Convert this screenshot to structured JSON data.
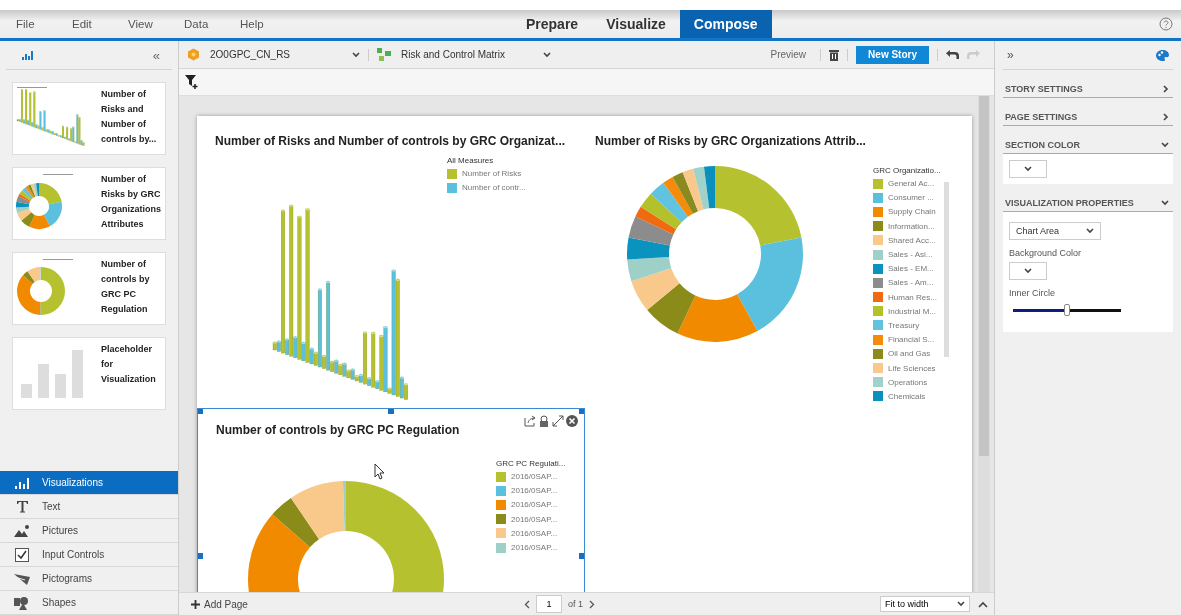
{
  "menu": [
    "File",
    "Edit",
    "View",
    "Data",
    "Help"
  ],
  "modes": [
    {
      "label": "Prepare",
      "selected": false
    },
    {
      "label": "Visualize",
      "selected": false
    },
    {
      "label": "Compose",
      "selected": true
    }
  ],
  "left_panel": {
    "collapse": "«",
    "thumbnails": [
      {
        "title": "Number of Risks and Number of controls by...",
        "kind": "bars"
      },
      {
        "title": "Number of Risks by GRC Organizations Attributes",
        "kind": "donut"
      },
      {
        "title": "Number of controls by GRC PC Regulation",
        "kind": "donut2"
      },
      {
        "title": "Placeholder for Visualization",
        "kind": "placeholder"
      }
    ],
    "tools": [
      {
        "label": "Visualizations",
        "kind": "viz",
        "selected": true
      },
      {
        "label": "Text",
        "kind": "text",
        "selected": false
      },
      {
        "label": "Pictures",
        "kind": "pictures",
        "selected": false
      },
      {
        "label": "Input Controls",
        "kind": "input",
        "selected": false
      },
      {
        "label": "Pictograms",
        "kind": "pictograms",
        "selected": false
      },
      {
        "label": "Shapes",
        "kind": "shapes",
        "selected": false
      }
    ]
  },
  "toolbar": {
    "dataset": "2O0GPC_CN_RS",
    "document": "Risk and Control Matrix",
    "preview": "Preview",
    "new_story": "New Story"
  },
  "charts": [
    {
      "kind": "bars",
      "selected": false,
      "title": "Number of Risks and Number of controls by GRC Organizat...",
      "legend_title": "All Measures",
      "legend": [
        {
          "label": "Number of Risks",
          "color": "#b5c12f"
        },
        {
          "label": "Number of contr...",
          "color": "#5bc0de"
        }
      ]
    },
    {
      "kind": "donut",
      "selected": false,
      "title": "Number of Risks by GRC Organizations Attrib...",
      "legend_title": "GRC Organizatio...",
      "legend": [
        {
          "label": "General Ac...",
          "color": "#b5c12f"
        },
        {
          "label": "Consumer ...",
          "color": "#5bc0de"
        },
        {
          "label": "Supply Chain",
          "color": "#f28a00"
        },
        {
          "label": "Information...",
          "color": "#8b8b1a"
        },
        {
          "label": "Shared Acc...",
          "color": "#f8c98a"
        },
        {
          "label": "Sales - Asi...",
          "color": "#9fd0c8"
        },
        {
          "label": "Sales - EM...",
          "color": "#0a93bf"
        },
        {
          "label": "Sales - Am...",
          "color": "#8c8c8c"
        },
        {
          "label": "Human Res...",
          "color": "#f06a12"
        },
        {
          "label": "Industrial M...",
          "color": "#b3c22a"
        },
        {
          "label": "Treasury",
          "color": "#62c3e0"
        },
        {
          "label": "Financial S...",
          "color": "#f58b0a"
        },
        {
          "label": "Oil and Gas",
          "color": "#8a8a1e"
        },
        {
          "label": "Life Sciences",
          "color": "#f9c88c"
        },
        {
          "label": "Operations",
          "color": "#a0d2c9"
        },
        {
          "label": "Chemicals",
          "color": "#0b8fbd"
        }
      ]
    },
    {
      "kind": "donut2",
      "selected": true,
      "title": "Number of controls by GRC PC Regulation",
      "legend_title": "GRC PC Regulati...",
      "legend": [
        {
          "label": "2016/0SAP...",
          "color": "#b5c12f"
        },
        {
          "label": "2016/0SAP...",
          "color": "#5bc0de"
        },
        {
          "label": "2016/0SAP...",
          "color": "#f28a00"
        },
        {
          "label": "2016/0SAP...",
          "color": "#8b8b1a"
        },
        {
          "label": "2016/0SAP...",
          "color": "#f8c98a"
        },
        {
          "label": "2016/0SAP...",
          "color": "#9fd0c8"
        }
      ]
    }
  ],
  "bottom_bar": {
    "add_page": "Add Page",
    "page": "1",
    "of": "of 1",
    "zoom": "Fit to width"
  },
  "right_panel": {
    "expand": "»",
    "sections": [
      {
        "title": "STORY SETTINGS",
        "expanded": false
      },
      {
        "title": "PAGE SETTINGS",
        "expanded": false
      },
      {
        "title": "SECTION COLOR",
        "expanded": true
      },
      {
        "title": "VISUALIZATION PROPERTIES",
        "expanded": true
      }
    ],
    "area_select": "Chart Area",
    "background_label": "Background Color",
    "slider": {
      "label": "Inner Circle",
      "level": 0.5
    }
  }
}
